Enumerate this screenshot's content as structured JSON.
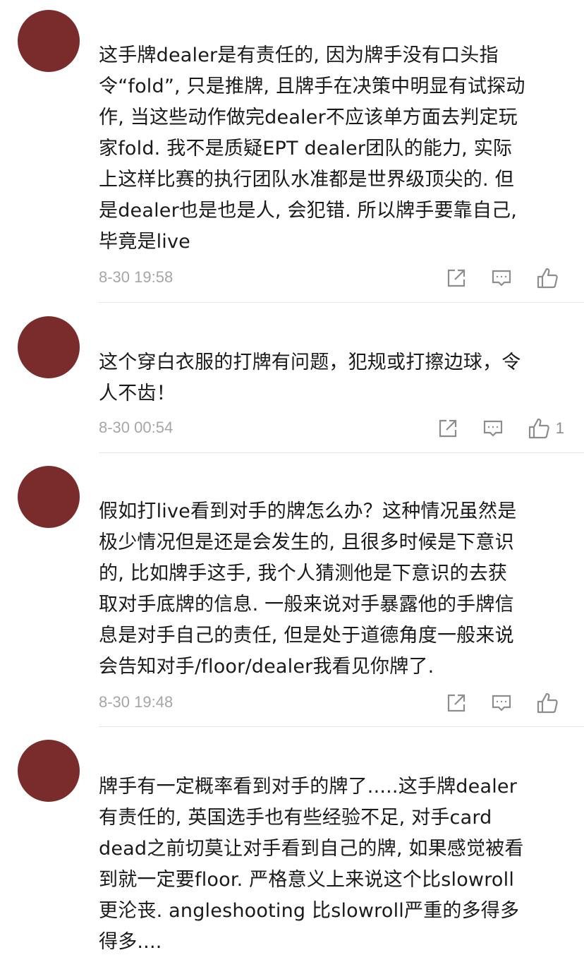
{
  "comments": [
    {
      "lines": [
        "这手牌dealer是有责任的, 因为牌手没有口头指",
        "令“fold”, 只是推牌, 且牌手在决策中明显有试探动",
        "作, 当这些动作做完dealer不应该单方面去判定玩",
        "家fold. 我不是质疑EPT dealer团队的能力, 实际",
        "上这样比赛的执行团队水准都是世界级顶尖的. 但",
        "是dealer也是也是人, 会犯错. 所以牌手要靠自己,",
        "毕竟是live"
      ],
      "time": "8-30 19:58",
      "likes": ""
    },
    {
      "lines": [
        "这个穿白衣服的打牌有问题，犯规或打擦边球，令",
        "人不齿！"
      ],
      "time": "8-30 00:54",
      "likes": "1"
    },
    {
      "lines": [
        "假如打live看到对手的牌怎么办？这种情况虽然是",
        "极少情况但是还是会发生的, 且很多时候是下意识",
        "的, 比如牌手这手, 我个人猜测他是下意识的去获",
        "取对手底牌的信息. 一般来说对手暴露他的手牌信",
        "息是对手自己的责任, 但是处于道德角度一般来说",
        "会告知对手/floor/dealer我看见你牌了."
      ],
      "time": "8-30 19:48",
      "likes": ""
    },
    {
      "lines": [
        "牌手有一定概率看到对手的牌了.....这手牌dealer",
        "有责任的, 英国选手也有些经验不足, 对手card",
        "dead之前切莫让对手看到自己的牌, 如果感觉被看",
        "到就一定要floor. 严格意义上来说这个比slowroll",
        "更沦丧. angleshooting 比slowroll严重的多得多",
        "得多...."
      ],
      "time": "",
      "likes": ""
    }
  ],
  "colors": {
    "avatar": "#7a2b2b",
    "text": "#1a1a1a",
    "meta": "#a6a6a6",
    "icon": "#8d8d8d",
    "divider": "#e6e6e6"
  },
  "icons": {
    "share": "share-icon",
    "reply": "reply-icon",
    "like": "thumbs-up-icon"
  }
}
